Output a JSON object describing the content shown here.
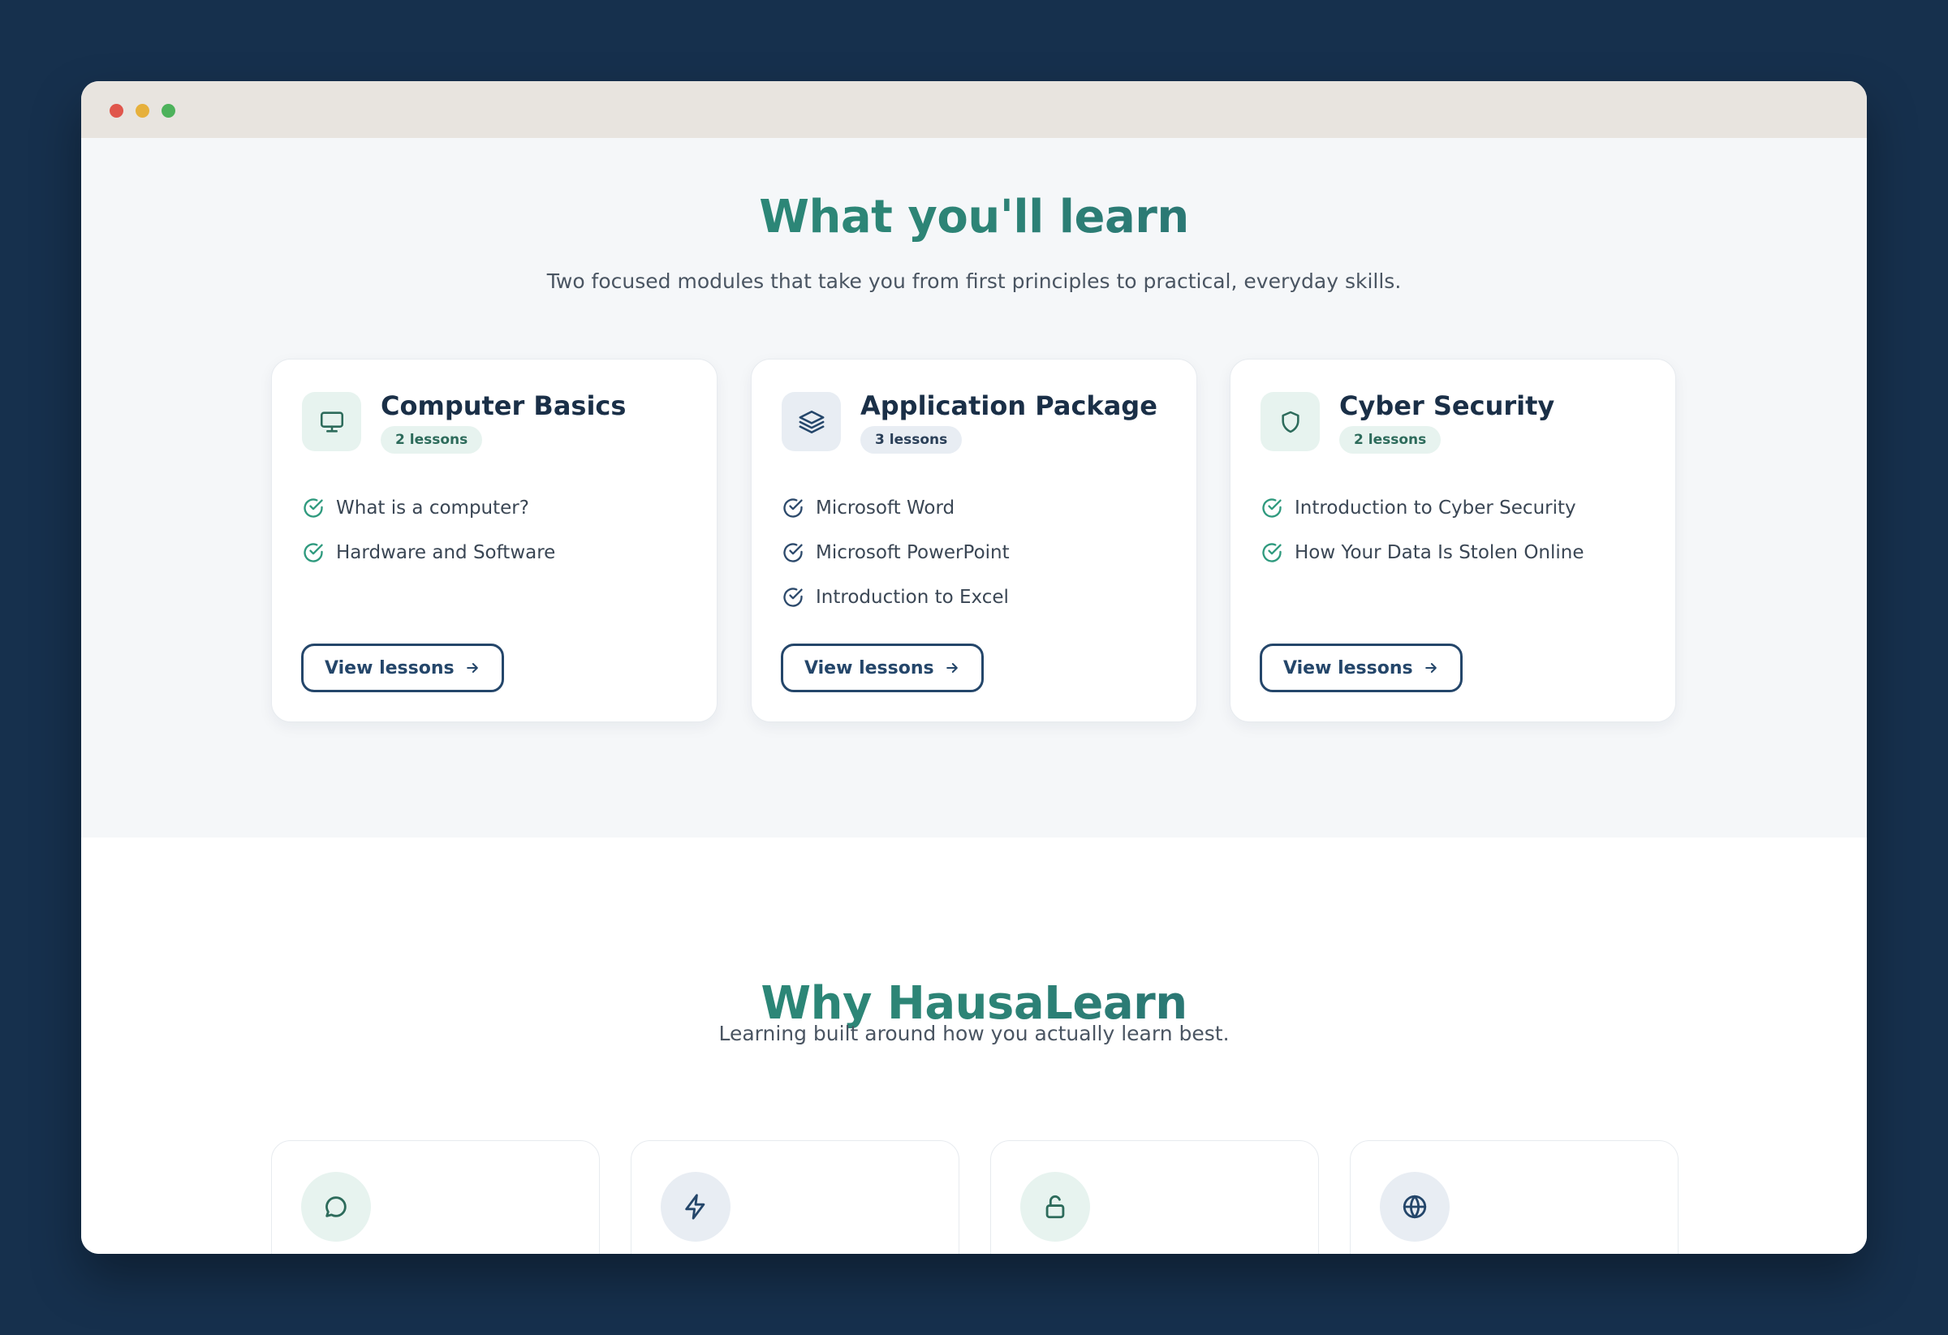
{
  "learn": {
    "title": "What you'll learn",
    "subtitle": "Two focused modules that take you from first principles to practical, everyday skills.",
    "modules": [
      {
        "title": "Computer Basics",
        "badge": "2 lessons",
        "icon": "monitor-icon",
        "lessons": [
          "What is a computer?",
          "Hardware and Software"
        ],
        "button": "View lessons"
      },
      {
        "title": "Application Package",
        "badge": "3 lessons",
        "icon": "layers-icon",
        "lessons": [
          "Microsoft Word",
          "Microsoft PowerPoint",
          "Introduction to Excel"
        ],
        "button": "View lessons"
      },
      {
        "title": "Cyber Security",
        "badge": "2 lessons",
        "icon": "shield-icon",
        "lessons": [
          "Introduction to Cyber Security",
          "How Your Data Is Stolen Online"
        ],
        "button": "View lessons"
      }
    ]
  },
  "why": {
    "title": "Why HausaLearn",
    "subtitle": "Learning built around how you actually learn best.",
    "features": [
      {
        "icon": "chat-bubble-icon"
      },
      {
        "icon": "lightning-icon"
      },
      {
        "icon": "unlock-icon"
      },
      {
        "icon": "globe-icon"
      }
    ]
  },
  "colors": {
    "background": "#16304d",
    "accent_green": "#2a8f7b",
    "accent_navy": "#24466a",
    "heading": "#1a2f47"
  }
}
